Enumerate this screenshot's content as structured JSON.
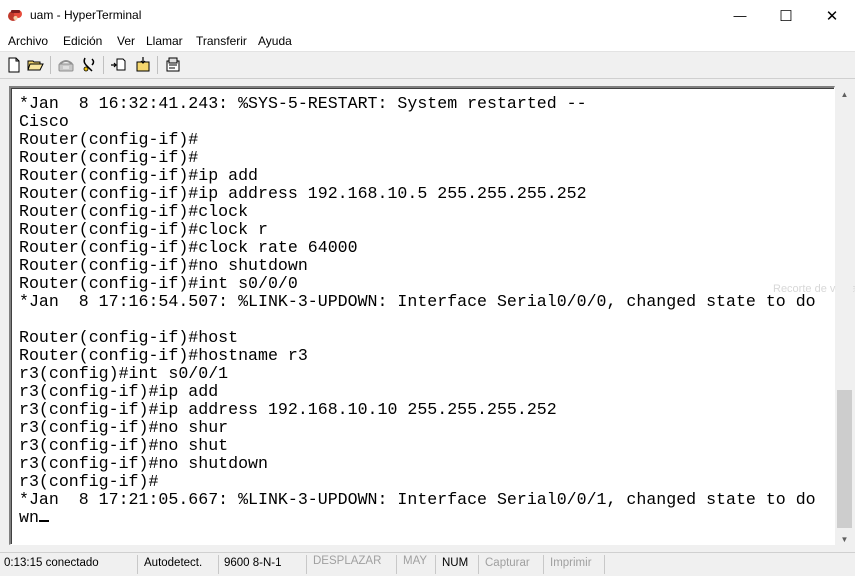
{
  "window": {
    "title": "uam - HyperTerminal",
    "minimize_glyph": "—",
    "maximize_glyph": "☐",
    "close_glyph": "✕"
  },
  "menu": [
    "Archivo",
    "Edición",
    "Ver",
    "Llamar",
    "Transferir",
    "Ayuda"
  ],
  "toolbar_icons": [
    "new-icon",
    "open-icon",
    "call-icon",
    "disconnect-icon",
    "send-icon",
    "receive-icon",
    "properties-icon"
  ],
  "terminal": {
    "lines": [
      "*Jan  8 16:32:41.243: %SYS-5-RESTART: System restarted --",
      "Cisco",
      "Router(config-if)#",
      "Router(config-if)#",
      "Router(config-if)#ip add",
      "Router(config-if)#ip address 192.168.10.5 255.255.255.252",
      "Router(config-if)#clock",
      "Router(config-if)#clock r",
      "Router(config-if)#clock rate 64000",
      "Router(config-if)#no shutdown",
      "Router(config-if)#int s0/0/0",
      "*Jan  8 17:16:54.507: %LINK-3-UPDOWN: Interface Serial0/0/0, changed state to do",
      "",
      "Router(config-if)#host",
      "Router(config-if)#hostname r3",
      "r3(config)#int s0/0/1",
      "r3(config-if)#ip add",
      "r3(config-if)#ip address 192.168.10.10 255.255.255.252",
      "r3(config-if)#no shur",
      "r3(config-if)#no shut",
      "r3(config-if)#no shutdown",
      "r3(config-if)#",
      "*Jan  8 17:21:05.667: %LINK-3-UPDOWN: Interface Serial0/0/1, changed state to do",
      "wn"
    ],
    "overlay_text": "Recorte de venta"
  },
  "status": {
    "connected": "0:13:15 conectado",
    "detect": "Autodetect.",
    "params": "9600 8-N-1",
    "scroll": "DESPLAZAR",
    "caps": "MAY",
    "num": "NUM",
    "capture": "Capturar",
    "print": "Imprimir"
  },
  "colors": {
    "terminal_bg": "#ffffff",
    "terminal_fg": "#000000",
    "chrome_bg": "#f0f0f0",
    "disabled_text": "#a0a0a0"
  }
}
